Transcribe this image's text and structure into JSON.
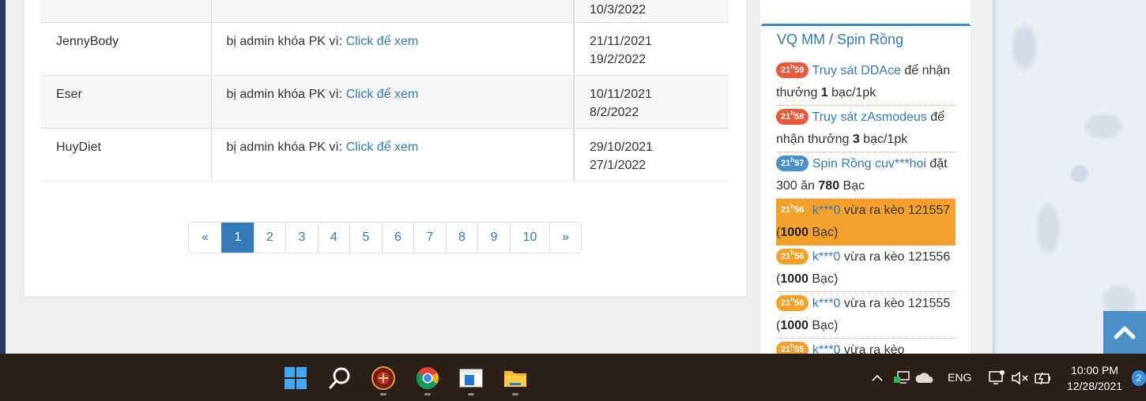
{
  "ban_list": {
    "reason_prefix": "bị admin khóa PK vì: ",
    "link_label": "Click để xem",
    "top_partial_date": "10/3/2022",
    "rows": [
      {
        "name": "JennyBody",
        "date_from": "21/11/2021",
        "date_to": "19/2/2022"
      },
      {
        "name": "Eser",
        "date_from": "10/11/2021",
        "date_to": "8/2/2022"
      },
      {
        "name": "HuyDiet",
        "date_from": "29/10/2021",
        "date_to": "27/1/2022"
      }
    ]
  },
  "pagination": {
    "prev": "«",
    "pages": [
      "1",
      "2",
      "3",
      "4",
      "5",
      "6",
      "7",
      "8",
      "9",
      "10"
    ],
    "active": "1",
    "next": "»"
  },
  "sidebar": {
    "title_left": "VQ MM",
    "separator": " / ",
    "title_right": "Spin Rồng",
    "feed": [
      {
        "hour": "21",
        "min": "59",
        "color": "red",
        "link": "Truy sát DDAce",
        "text1": " để nhận thưởng ",
        "bold": "1",
        "text2": " bạc/1pk"
      },
      {
        "hour": "21",
        "min": "58",
        "color": "red",
        "link": "Truy sát zAsmodeus",
        "text1": " để nhận thưởng ",
        "bold": "3",
        "text2": " bạc/1pk"
      },
      {
        "hour": "21",
        "min": "57",
        "color": "blue",
        "link": "Spin Rồng cuv***hoi",
        "text1": " đặt 300 ăn ",
        "bold": "780",
        "text2": " Bạc"
      },
      {
        "hour": "21",
        "min": "56",
        "color": "orange",
        "link": "k***0",
        "text1": " vừa ra kèo 121557 (",
        "bold": "1000",
        "text2": " Bạc)",
        "highlight": true
      },
      {
        "hour": "21",
        "min": "56",
        "color": "orange",
        "link": "k***0",
        "text1": " vừa ra kèo 121556 (",
        "bold": "1000",
        "text2": " Bạc)"
      },
      {
        "hour": "21",
        "min": "56",
        "color": "orange",
        "link": "k***0",
        "text1": " vừa ra kèo 121555 (",
        "bold": "1000",
        "text2": " Bạc)"
      },
      {
        "hour": "21",
        "min": "55",
        "color": "orange",
        "link": "k***0",
        "text1": " vừa ra kèo",
        "bold": "",
        "text2": ""
      }
    ]
  },
  "taskbar": {
    "language": "ENG",
    "time": "10:00 PM",
    "date": "12/28/2021",
    "notifications": "2",
    "icons": [
      "windows-start-icon",
      "search-icon",
      "game-app-icon",
      "chrome-icon",
      "app-window-icon",
      "file-explorer-icon"
    ]
  },
  "colors": {
    "link": "#337ab7",
    "accent_blue": "#3c8dbc",
    "highlight_orange": "#f5a02a",
    "badge_red": "#e95a3a",
    "taskbar": "#2b1f17"
  }
}
